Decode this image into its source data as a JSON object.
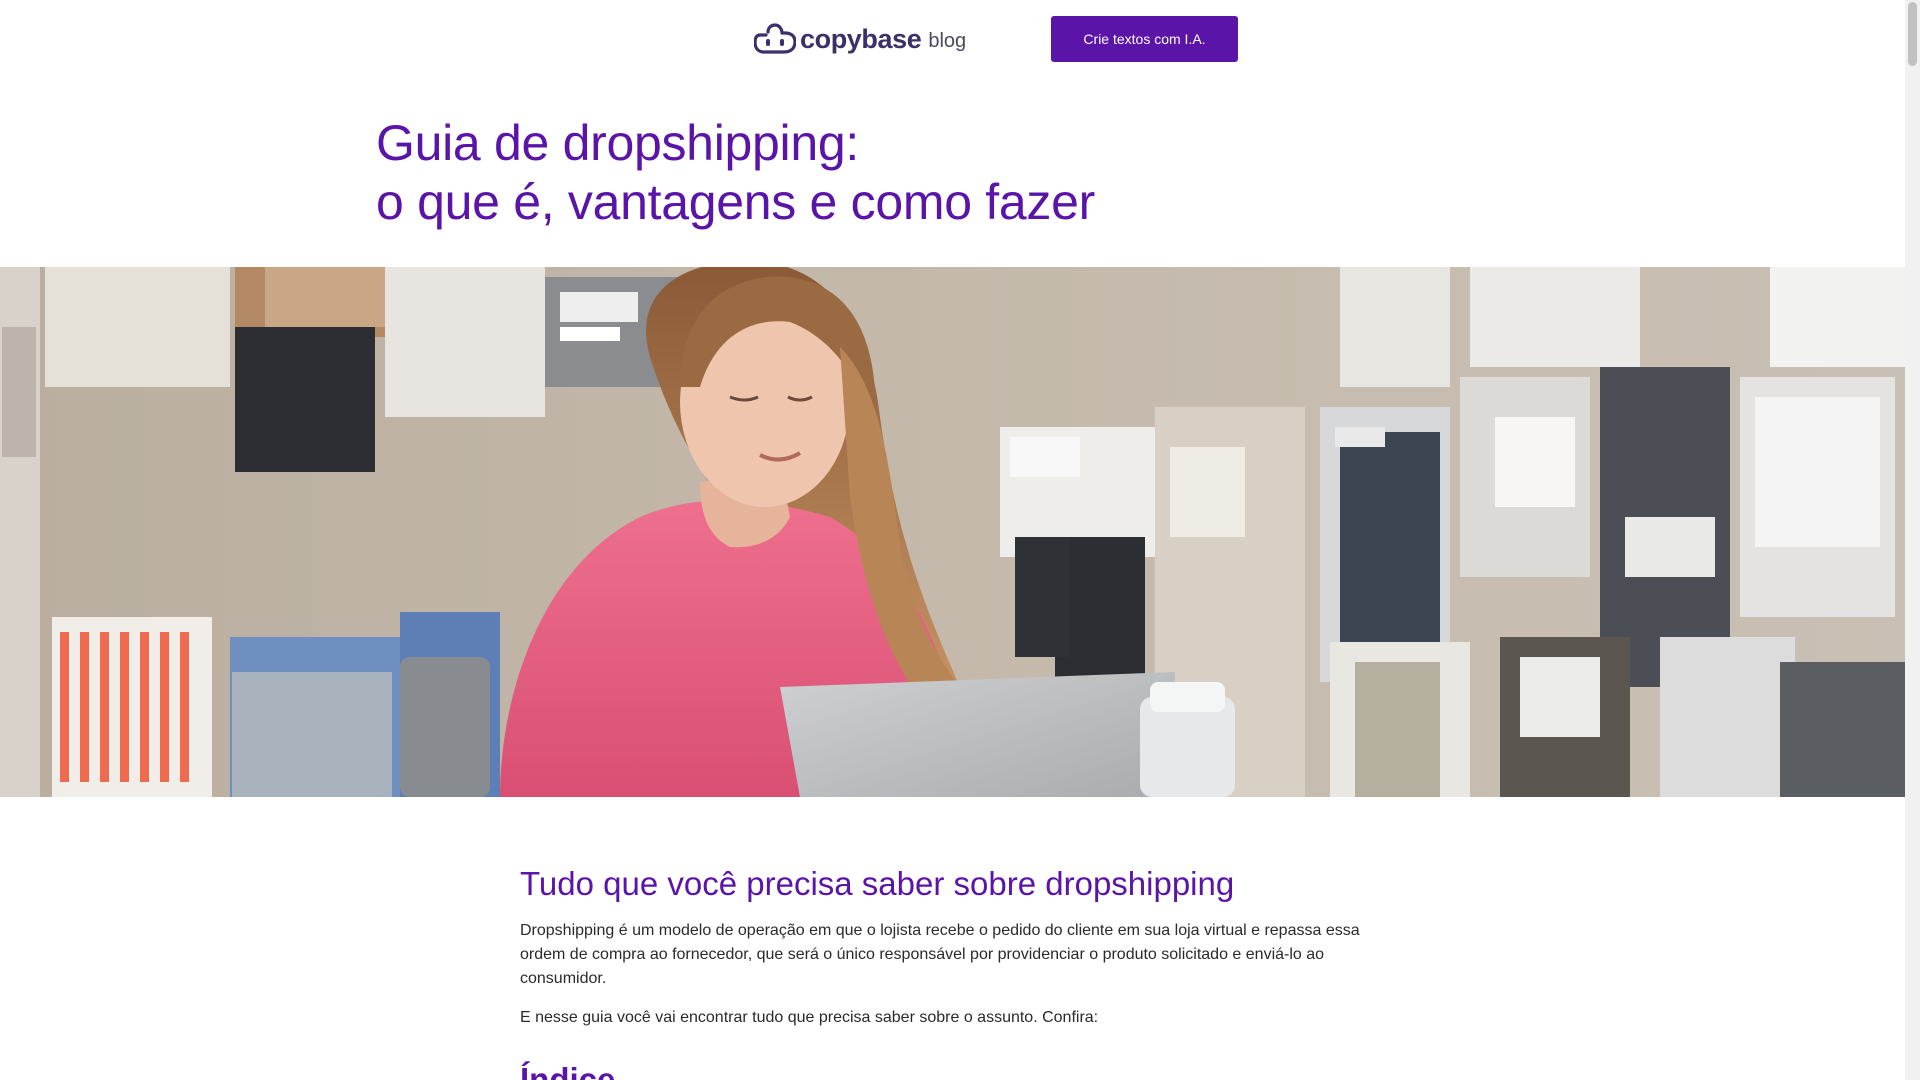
{
  "header": {
    "logo": {
      "wordmark": "copybase",
      "suffix": "blog",
      "icon": "copybase-logo-icon"
    },
    "cta_label": "Crie textos com I.A."
  },
  "article": {
    "title_line1": "Guia de dropshipping:",
    "title_line2": "o que é, vantagens e como fazer",
    "hero_image": "woman-in-pink-sweater-using-laptop-with-fabric-swatches-wall",
    "section_title": "Tudo que você precisa saber sobre dropshipping",
    "paragraphs": [
      "Dropshipping é um modelo de operação em que o lojista recebe o pedido do cliente em sua loja virtual e repassa essa ordem de compra ao fornecedor, que será o único responsável por providenciar o produto solicitado e enviá-lo ao consumidor.",
      "E nesse guia você vai encontrar tudo que precisa saber sobre o assunto. Confira:"
    ],
    "index_title": "Índice"
  },
  "colors": {
    "brand_purple": "#5b14a8",
    "logo_navy": "#3d2f68",
    "body_text": "#2a2a2a",
    "background": "#ffffff"
  }
}
